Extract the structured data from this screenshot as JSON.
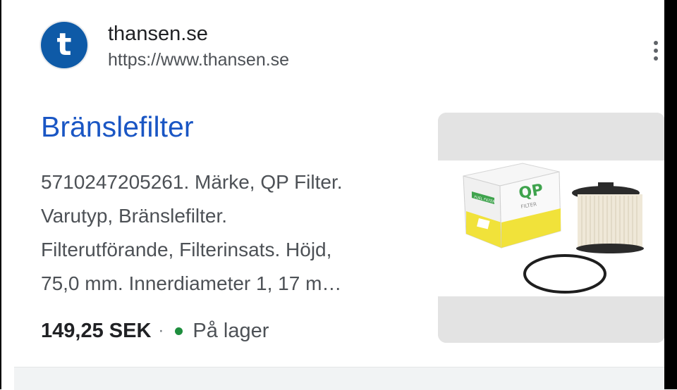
{
  "site": {
    "favicon_letter": "t",
    "name": "thansen.se",
    "url": "https://www.thansen.se"
  },
  "result": {
    "title": "Bränslefilter",
    "snippet_lines": [
      "5710247205261. Märke, QP Filter.",
      "Varutyp, Bränslefilter.",
      "Filterutförande, Filterinsats. Höjd,",
      "75,0 mm. Innerdiameter 1, 17 m…"
    ],
    "price": "149,25 SEK",
    "separator": "·",
    "availability": "På lager"
  },
  "thumbnail": {
    "brand_logo": "QP",
    "brand_sub": "FILTER",
    "label_band": "FUEL FILTER",
    "product_items": [
      "box",
      "filter-insert",
      "o-ring"
    ]
  },
  "colors": {
    "title_link": "#1a56c4",
    "stock_dot": "#1e8e3e",
    "favicon_bg": "#0e5aa7"
  },
  "icons": {
    "menu": "more-vert-icon"
  }
}
